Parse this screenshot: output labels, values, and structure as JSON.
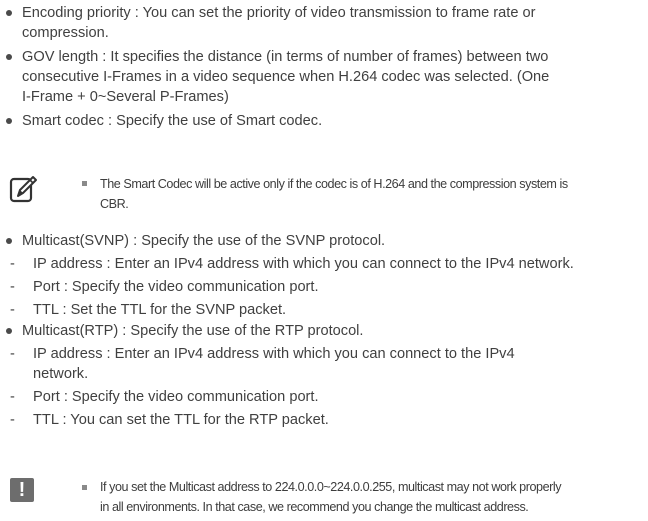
{
  "bullets_top": [
    {
      "line1": "Encoding priority : You can set the priority of video transmission to frame rate or",
      "line2": "compression."
    },
    {
      "line1": "GOV length : It specifies the distance (in terms of number of frames) between two",
      "line2": "consecutive I-Frames in a video sequence when H.264 codec was selected. (One",
      "line3": "I-Frame + 0~Several P-Frames)"
    },
    {
      "line1": "Smart codec : Specify the use of Smart codec."
    }
  ],
  "note1": {
    "icon": "memo-pencil-icon",
    "line1": "The Smart Codec will be active only if the codec is of H.264 and the compression system is",
    "line2": "CBR."
  },
  "multicast_svnp": {
    "title": "Multicast(SVNP) : Specify the use of the SVNP protocol.",
    "items": [
      "IP address : Enter an IPv4 address with which you can connect to the IPv4 network.",
      "Port : Specify the video communication port.",
      "TTL : Set the TTL for the SVNP packet."
    ]
  },
  "multicast_rtp": {
    "title": "Multicast(RTP) : Specify the use of the RTP protocol.",
    "ip_line1": "IP address : Enter an IPv4 address with which you can connect to the IPv4",
    "ip_line2": "network.",
    "port": "Port : Specify the video communication port.",
    "ttl": "TTL : You can set the TTL for the RTP packet."
  },
  "note2": {
    "icon": "warning-exclamation-icon",
    "icon_glyph": "!",
    "line1": "If you set the Multicast address to 224.0.0.0~224.0.0.255, multicast may not work properly",
    "line2": "in all environments. In that case, we recommend you change the multicast address."
  },
  "dash": "-"
}
